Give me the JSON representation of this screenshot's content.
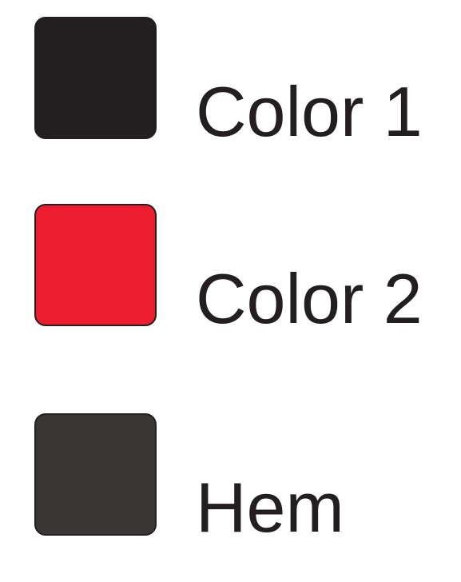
{
  "legend": {
    "items": [
      {
        "label": "Color 1",
        "color": "#231f20"
      },
      {
        "label": "Color 2",
        "color": "#ed1c2e"
      },
      {
        "label": "Hem",
        "color": "#393735"
      }
    ]
  }
}
